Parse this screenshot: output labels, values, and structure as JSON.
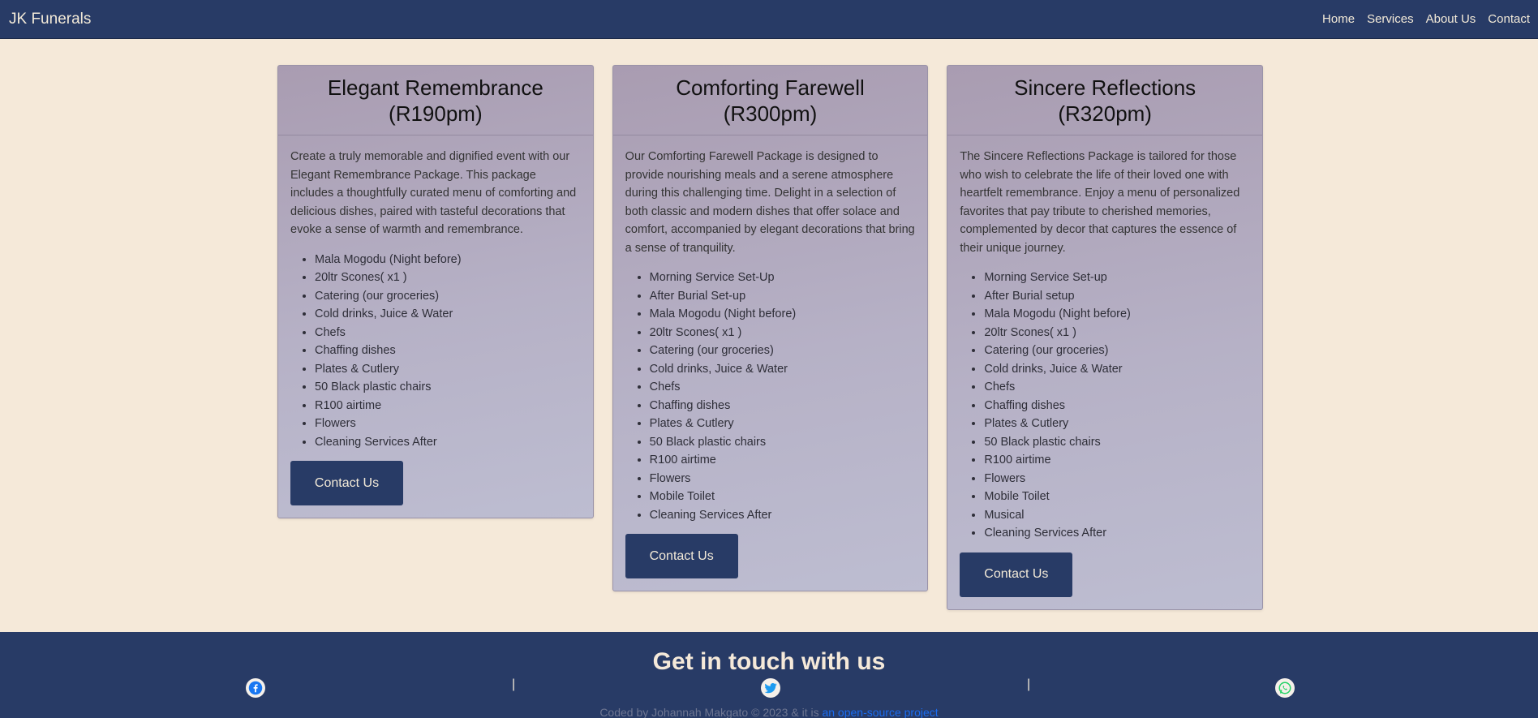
{
  "nav": {
    "brand": "JK Funerals",
    "links": [
      "Home",
      "Services",
      "About Us",
      "Contact"
    ]
  },
  "cards": [
    {
      "title_line1": "Elegant Remembrance",
      "title_line2": "(R190pm)",
      "text": "Create a truly memorable and dignified event with our Elegant Remembrance Package. This package includes a thoughtfully curated menu of comforting and delicious dishes, paired with tasteful decorations that evoke a sense of warmth and remembrance.",
      "items": [
        "Mala Mogodu (Night before)",
        "20ltr Scones( x1 )",
        "Catering (our groceries)",
        "Cold drinks, Juice & Water",
        "Chefs",
        "Chaffing dishes",
        "Plates & Cutlery",
        "50 Black plastic chairs",
        "R100 airtime",
        "Flowers",
        "Cleaning Services After"
      ],
      "button": "Contact Us"
    },
    {
      "title_line1": "Comforting Farewell",
      "title_line2": "(R300pm)",
      "text": "Our Comforting Farewell Package is designed to provide nourishing meals and a serene atmosphere during this challenging time. Delight in a selection of both classic and modern dishes that offer solace and comfort, accompanied by elegant decorations that bring a sense of tranquility.",
      "items": [
        "Morning Service Set-Up",
        "After Burial Set-up",
        "Mala Mogodu (Night before)",
        "20ltr Scones( x1 )",
        "Catering (our groceries)",
        "Cold drinks, Juice & Water",
        "Chefs",
        "Chaffing dishes",
        "Plates & Cutlery",
        "50 Black plastic chairs",
        "R100 airtime",
        "Flowers",
        "Mobile Toilet",
        "Cleaning Services After"
      ],
      "button": "Contact Us"
    },
    {
      "title_line1": "Sincere Reflections",
      "title_line2": "(R320pm)",
      "text": "The Sincere Reflections Package is tailored for those who wish to celebrate the life of their loved one with heartfelt remembrance. Enjoy a menu of personalized favorites that pay tribute to cherished memories, complemented by decor that captures the essence of their unique journey.",
      "items": [
        "Morning Service Set-up",
        "After Burial setup",
        "Mala Mogodu (Night before)",
        "20ltr Scones( x1 )",
        "Catering (our groceries)",
        "Cold drinks, Juice & Water",
        "Chefs",
        "Chaffing dishes",
        "Plates & Cutlery",
        "50 Black plastic chairs",
        "R100 airtime",
        "Flowers",
        "Mobile Toilet",
        "Musical",
        "Cleaning Services After"
      ],
      "button": "Contact Us"
    }
  ],
  "footer": {
    "title": "Get in touch with us",
    "separator": "|",
    "social_icons": [
      "facebook-icon",
      "twitter-icon",
      "whatsapp-icon"
    ],
    "credit_text": "Coded by Johannah Makgato © 2023 & it is ",
    "credit_link": "an open-source project"
  },
  "colors": {
    "navy": "#283b66",
    "cream": "#f5e9d9",
    "facebook": "#1877f2",
    "twitter": "#1d9bf0",
    "whatsapp": "#25d366"
  }
}
